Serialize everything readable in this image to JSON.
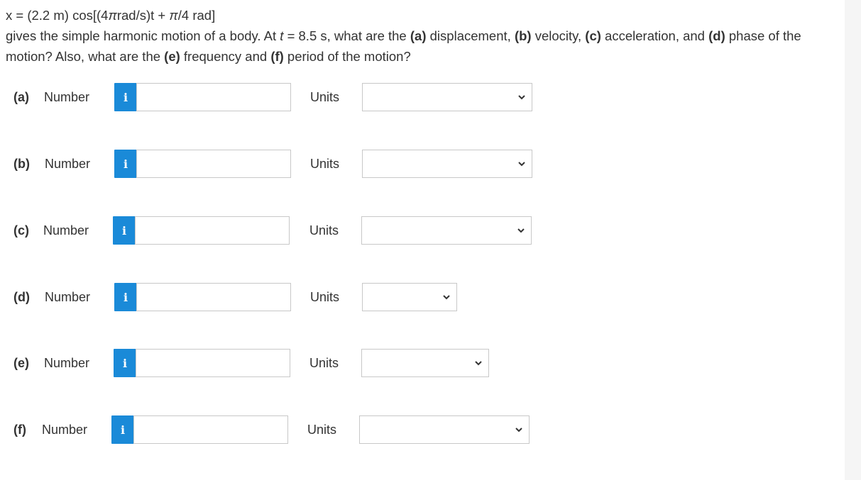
{
  "question": {
    "equation": {
      "lead": "x = (2.2 m) cos[(4",
      "pi1": "π",
      "mid": "rad/s)t + ",
      "pi2": "π",
      "tail": "/4 rad]"
    },
    "text_1": "gives the simple harmonic motion of a body. At ",
    "t_var": "t",
    "text_2": " = 8.5 s, what are the ",
    "a_tag": "(a)",
    "a_text": " displacement, ",
    "b_tag": "(b)",
    "b_text": " velocity, ",
    "c_tag": "(c)",
    "c_text": " acceleration, and ",
    "d_tag": "(d)",
    "d_text": " phase of the motion? Also, what are the ",
    "e_tag": "(e)",
    "e_text": " frequency and ",
    "f_tag": "(f)",
    "f_text": " period of the motion?"
  },
  "parts": [
    {
      "label": "(a)",
      "number_label": "Number",
      "info_icon": "i",
      "value": "",
      "units_label": "Units",
      "unit_selected": ""
    },
    {
      "label": "(b)",
      "number_label": "Number",
      "info_icon": "i",
      "value": "",
      "units_label": "Units",
      "unit_selected": ""
    },
    {
      "label": "(c)",
      "number_label": "Number",
      "info_icon": "i",
      "value": "",
      "units_label": "Units",
      "unit_selected": ""
    },
    {
      "label": "(d)",
      "number_label": "Number",
      "info_icon": "i",
      "value": "",
      "units_label": "Units",
      "unit_selected": ""
    },
    {
      "label": "(e)",
      "number_label": "Number",
      "info_icon": "i",
      "value": "",
      "units_label": "Units",
      "unit_selected": ""
    },
    {
      "label": "(f)",
      "number_label": "Number",
      "info_icon": "i",
      "value": "",
      "units_label": "Units",
      "unit_selected": ""
    }
  ],
  "colors": {
    "info_button": "#1a8ad8",
    "input_border": "#c8c8c8",
    "text": "#333333"
  },
  "icons": {
    "info": "info-icon",
    "dropdown": "chevron-down-icon"
  }
}
